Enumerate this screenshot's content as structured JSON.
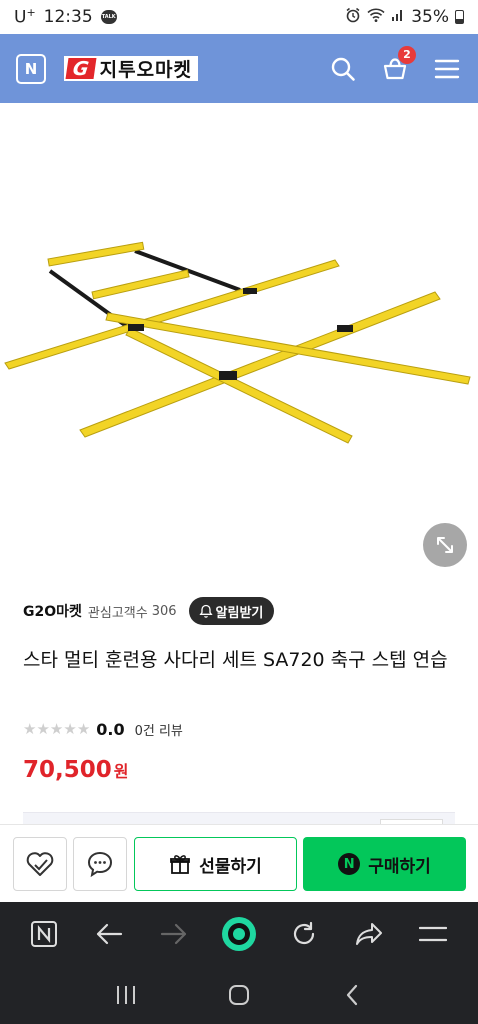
{
  "status_bar": {
    "carrier": "U",
    "carrier_sup": "+",
    "time": "12:35",
    "talk_badge": "TALK",
    "battery": "35%"
  },
  "header": {
    "n_label": "N",
    "brand_g": "G",
    "brand_name": "지투오마켓",
    "cart_count": "2",
    "accent_color": "#6f94d9"
  },
  "seller": {
    "name": "G2O마켓",
    "follower_label": "관심고객수",
    "follower_count": "306",
    "notify_label": "알림받기"
  },
  "product": {
    "title": "스타 멀티 훈련용 사다리 세트 SA720 축구 스텝 연습",
    "rating_stars": 0,
    "rating_value": "0.0",
    "review_count": "0건 리뷰",
    "price": "70,500",
    "currency": "원",
    "price_color": "#e0242a"
  },
  "actions": {
    "gift_label": "선물하기",
    "buy_label": "구매하기",
    "buy_n": "N",
    "buy_color": "#03c75a"
  },
  "browser_bar": {
    "n_label": "N"
  }
}
